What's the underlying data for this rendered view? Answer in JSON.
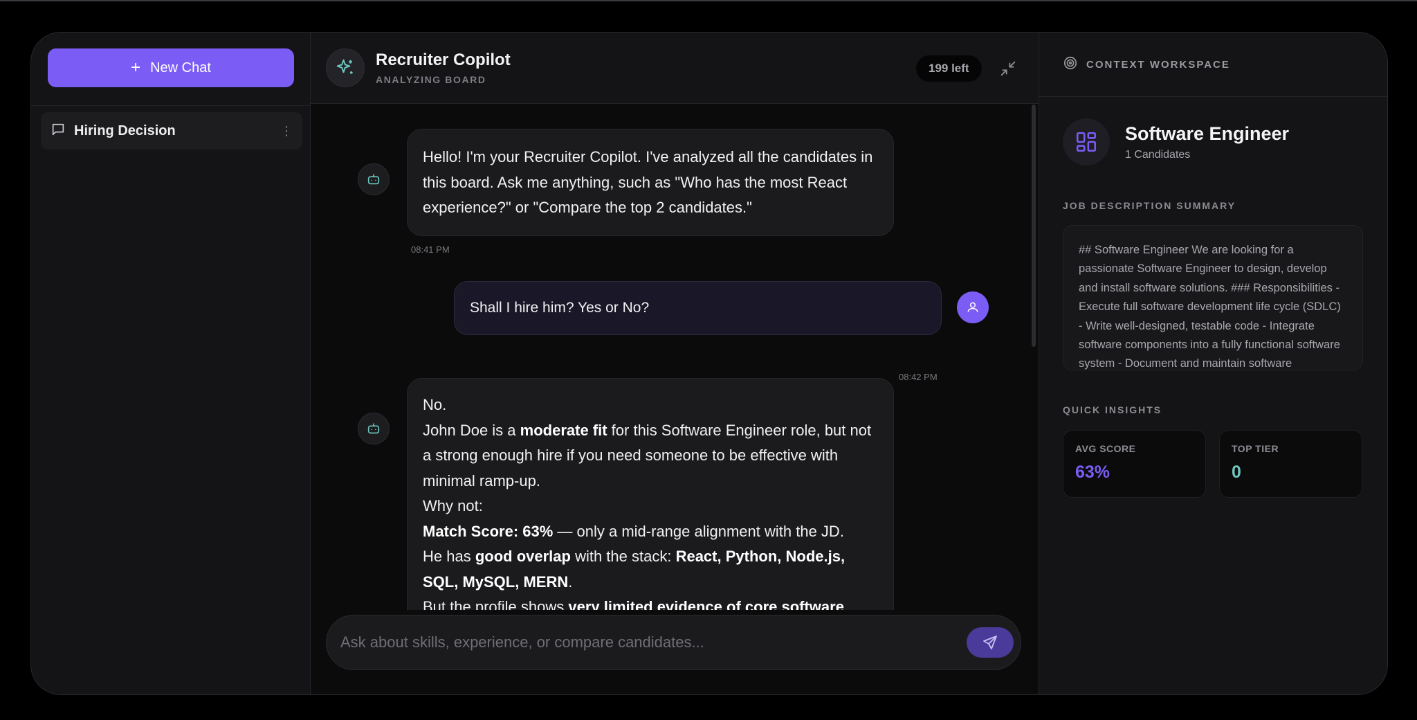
{
  "sidebar": {
    "new_chat_label": "New Chat",
    "chats": [
      {
        "label": "Hiring Decision"
      }
    ]
  },
  "header": {
    "title": "Recruiter Copilot",
    "subtitle": "ANALYZING BOARD",
    "badge": "199 left"
  },
  "messages": [
    {
      "role": "bot",
      "text": "Hello! I'm your Recruiter Copilot. I've analyzed all the candidates in this board. Ask me anything, such as \"Who has the most React experience?\" or \"Compare the top 2 candidates.\"",
      "time": "08:41 PM"
    },
    {
      "role": "user",
      "text": "Shall I hire him? Yes or No?",
      "time": "08:42 PM"
    },
    {
      "role": "bot",
      "lines": {
        "l1": "No.",
        "l2a": "John Doe is a ",
        "l2b": "moderate fit",
        "l2c": " for this Software Engineer role, but not a strong enough hire if you need someone to be effective with minimal ramp-up.",
        "l3": "Why not:",
        "l4a": "Match Score: 63%",
        "l4b": " — only a mid-range alignment with the JD.",
        "l5a": "He has ",
        "l5b": "good overlap",
        "l5c": " with the stack: ",
        "l5d": "React, Python, Node.js, SQL, MySQL, MERN",
        "l5e": ".",
        "l6a": "But the profile shows ",
        "l6b": "very limited evidence of core software"
      }
    }
  ],
  "input": {
    "placeholder": "Ask about skills, experience, or compare candidates..."
  },
  "context": {
    "title": "CONTEXT WORKSPACE",
    "job_title": "Software Engineer",
    "job_sub": "1 Candidates",
    "jd_label": "JOB DESCRIPTION SUMMARY",
    "jd_text": "## Software Engineer We are looking for a passionate Software Engineer to design, develop and install software solutions. ### Responsibilities - Execute full software development life cycle (SDLC) - Write well-designed, testable code - Integrate software components into a fully functional software system - Document and maintain software",
    "insights_label": "QUICK INSIGHTS",
    "stats": [
      {
        "label": "AVG SCORE",
        "value": "63%",
        "color": "#7b5cf5"
      },
      {
        "label": "TOP TIER",
        "value": "0",
        "color": "#6fc7c0"
      }
    ]
  },
  "colors": {
    "accent": "#7b5cf5",
    "teal": "#6fc7c0"
  }
}
